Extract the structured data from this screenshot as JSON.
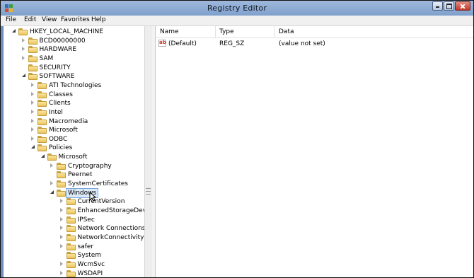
{
  "window": {
    "title": "Registry Editor"
  },
  "menu": [
    "File",
    "Edit",
    "View",
    "Favorites",
    "Help"
  ],
  "tree": [
    {
      "label": "HKEY_LOCAL_MACHINE",
      "depth": 0,
      "state": "expanded"
    },
    {
      "label": "BCD00000000",
      "depth": 1,
      "state": "collapsed"
    },
    {
      "label": "HARDWARE",
      "depth": 1,
      "state": "collapsed"
    },
    {
      "label": "SAM",
      "depth": 1,
      "state": "collapsed"
    },
    {
      "label": "SECURITY",
      "depth": 1,
      "state": "none"
    },
    {
      "label": "SOFTWARE",
      "depth": 1,
      "state": "expanded"
    },
    {
      "label": "ATI Technologies",
      "depth": 2,
      "state": "collapsed"
    },
    {
      "label": "Classes",
      "depth": 2,
      "state": "collapsed"
    },
    {
      "label": "Clients",
      "depth": 2,
      "state": "collapsed"
    },
    {
      "label": "Intel",
      "depth": 2,
      "state": "collapsed"
    },
    {
      "label": "Macromedia",
      "depth": 2,
      "state": "collapsed"
    },
    {
      "label": "Microsoft",
      "depth": 2,
      "state": "collapsed"
    },
    {
      "label": "ODBC",
      "depth": 2,
      "state": "collapsed"
    },
    {
      "label": "Policies",
      "depth": 2,
      "state": "expanded"
    },
    {
      "label": "Microsoft",
      "depth": 3,
      "state": "expanded"
    },
    {
      "label": "Cryptography",
      "depth": 4,
      "state": "collapsed"
    },
    {
      "label": "Peernet",
      "depth": 4,
      "state": "none"
    },
    {
      "label": "SystemCertificates",
      "depth": 4,
      "state": "collapsed"
    },
    {
      "label": "Windows",
      "depth": 4,
      "state": "expanded",
      "selected": true
    },
    {
      "label": "CurrentVersion",
      "depth": 5,
      "state": "collapsed"
    },
    {
      "label": "EnhancedStorageDevic",
      "depth": 5,
      "state": "collapsed"
    },
    {
      "label": "IPSec",
      "depth": 5,
      "state": "collapsed"
    },
    {
      "label": "Network Connections",
      "depth": 5,
      "state": "collapsed"
    },
    {
      "label": "NetworkConnectivitySt",
      "depth": 5,
      "state": "collapsed"
    },
    {
      "label": "safer",
      "depth": 5,
      "state": "collapsed"
    },
    {
      "label": "System",
      "depth": 5,
      "state": "none"
    },
    {
      "label": "WcmSvc",
      "depth": 5,
      "state": "collapsed"
    },
    {
      "label": "WSDAPI",
      "depth": 5,
      "state": "collapsed"
    }
  ],
  "columns": [
    "Name",
    "Type",
    "Data"
  ],
  "values": [
    {
      "icon": "string-value-icon",
      "name": "(Default)",
      "type": "REG_SZ",
      "data": "(value not set)"
    }
  ]
}
